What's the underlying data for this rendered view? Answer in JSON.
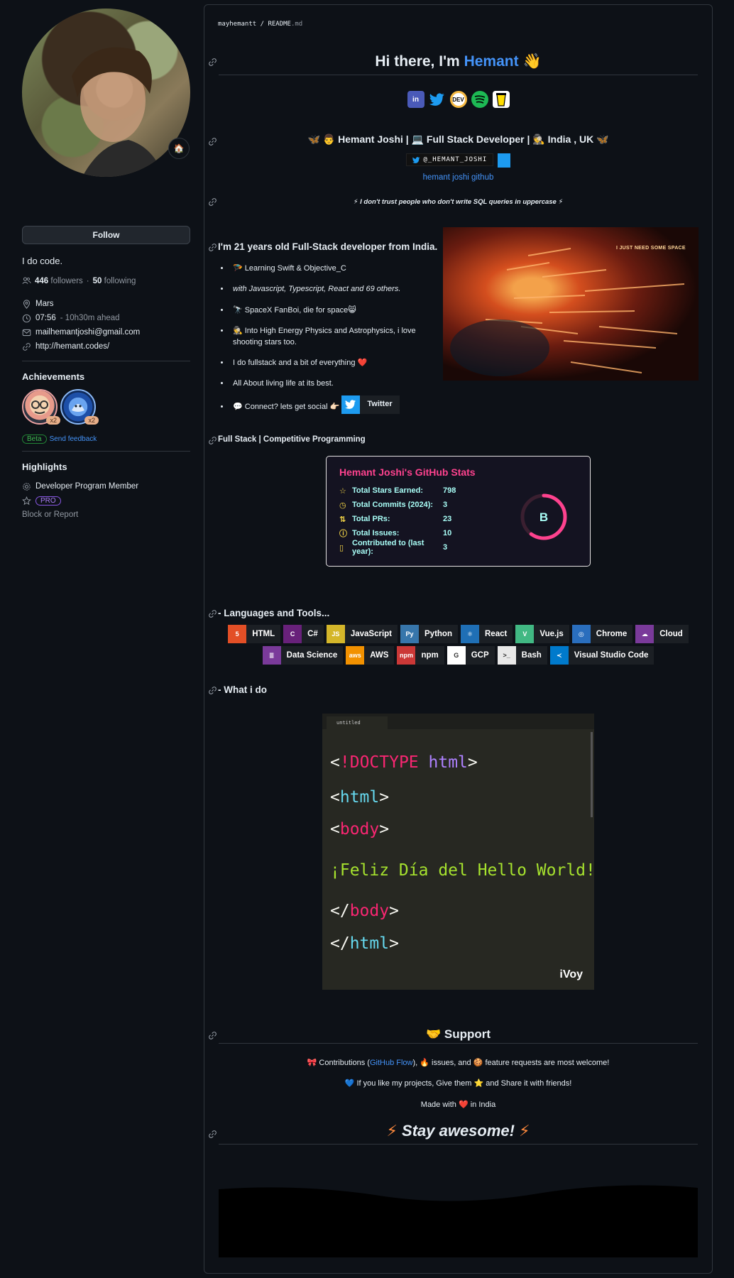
{
  "profile": {
    "status_emoji": "🏠",
    "follow_label": "Follow",
    "bio": "I do code.",
    "followers": "446",
    "followers_label": "followers",
    "following": "50",
    "following_label": "following",
    "location": "Mars",
    "local_time": "07:56",
    "time_ahead": "- 10h30m ahead",
    "email": "mailhemantjoshi@gmail.com",
    "website": "http://hemant.codes/",
    "achievements_title": "Achievements",
    "achievement_badges": [
      {
        "count": "x2"
      },
      {
        "count": "x2"
      }
    ],
    "beta_label": "Beta",
    "send_feedback": "Send feedback",
    "highlights_title": "Highlights",
    "developer_program": "Developer Program Member",
    "pro_label": "PRO",
    "block_report": "Block or Report"
  },
  "readme": {
    "breadcrumb_user": "mayhemantt",
    "breadcrumb_sep": "/",
    "breadcrumb_file": "README",
    "breadcrumb_ext": ".md",
    "greeting_prefix": "Hi there, I'm ",
    "greeting_name": "Hemant",
    "greeting_emoji": "👋",
    "social_icons": [
      "linkedin-icon",
      "twitter-icon",
      "dev-icon",
      "spotify-icon",
      "buymeacoffee-icon"
    ],
    "tagline": "🦋 👨 Hemant Joshi | 💻 Full Stack Developer | 🕵️ India , UK 🦋",
    "twitter_handle": "@_HEMANT_JOSHI",
    "github_alt": "hemant joshi github",
    "quote": "⚡ I don't trust people who don't write SQL queries in uppercase ⚡",
    "intro_heading": "I'm 21 years old Full-Stack developer from India.",
    "galaxy_caption": "I JUST NEED SOME SPACE",
    "bullets": [
      "🪂 Learning Swift & Objective_C",
      "with Javascript, Typescript, React and 69 others.",
      "🔭 SpaceX FanBoi, die for space😸",
      "🕵️ Into High Energy Physics and Astrophysics, i love shooting stars too.",
      "I do fullstack and a bit of everything ❤️",
      "All About living life at its best.",
      "💬 Connect? lets get social 👉🏻"
    ],
    "twitter_button": "Twitter",
    "fullstack_heading": "Full Stack | Competitive Programming",
    "stats": {
      "title": "Hemant Joshi's GitHub Stats",
      "rows": [
        {
          "label": "Total Stars Earned:",
          "value": "798",
          "icon": "star-icon"
        },
        {
          "label": "Total Commits (2024):",
          "value": "3",
          "icon": "history-icon"
        },
        {
          "label": "Total PRs:",
          "value": "23",
          "icon": "pull-request-icon"
        },
        {
          "label": "Total Issues:",
          "value": "10",
          "icon": "issue-icon"
        },
        {
          "label": "Contributed to (last year):",
          "value": "3",
          "icon": "repo-icon"
        }
      ],
      "rank": "B",
      "rank_progress": 0.6,
      "colors": {
        "title": "#fe428e",
        "text": "#a9fef7",
        "icon": "#f8d847",
        "bg": "#141321"
      }
    },
    "languages_heading": "- Languages and Tools...",
    "tools_row1": [
      {
        "name": "HTML",
        "color": "#e34f26",
        "glyph": "5"
      },
      {
        "name": "C#",
        "color": "#68217a",
        "glyph": "C"
      },
      {
        "name": "JavaScript",
        "color": "#d4b62a",
        "glyph": "JS"
      },
      {
        "name": "Python",
        "color": "#3776ab",
        "glyph": "Py"
      },
      {
        "name": "React",
        "color": "#1f6fb5",
        "glyph": "⚛"
      },
      {
        "name": "Vue.js",
        "color": "#41b883",
        "glyph": "V"
      },
      {
        "name": "Chrome",
        "color": "#2a6ebd",
        "glyph": "◎"
      },
      {
        "name": "Cloud",
        "color": "#7a3a9a",
        "glyph": "☁"
      }
    ],
    "tools_row2": [
      {
        "name": "Data Science",
        "color": "#7a3a9a",
        "glyph": "≣"
      },
      {
        "name": "AWS",
        "color": "#f29100",
        "glyph": "aws"
      },
      {
        "name": "npm",
        "color": "#cb3837",
        "glyph": "npm"
      },
      {
        "name": "GCP",
        "color": "#ffffff",
        "glyph": "G"
      },
      {
        "name": "Bash",
        "color": "#e8e8e8",
        "glyph": ">_"
      },
      {
        "name": "Visual Studio Code",
        "color": "#007acc",
        "glyph": "≺"
      }
    ],
    "what_i_do_heading": "- What i do",
    "code_tab": "untitled",
    "code_lines": {
      "l1_open": "<",
      "l1_bang": "!",
      "l1_doctype": "DOCTYPE",
      "l1_html": " html",
      "l1_close": ">",
      "l2_open": "<",
      "l2_tag": "html",
      "l2_close": ">",
      "l3_open": "<",
      "l3_tag": "body",
      "l3_close": ">",
      "l4_text": "¡Feliz Día del Hello World!",
      "l5_open": "</",
      "l5_tag": "body",
      "l5_close": ">",
      "l6_open": "</",
      "l6_tag": "html",
      "l6_close": ">"
    },
    "code_watermark": "iVoy",
    "support_heading": "🤝 Support",
    "support_line1_a": "🎀 Contributions (",
    "support_line1_link": "GitHub Flow",
    "support_line1_b": "), 🔥 issues, and 🍪 feature requests are most welcome!",
    "support_line2": "💙 If you like my projects, Give them ⭐ and Share it with friends!",
    "support_line3": "Made with ❤️ in India",
    "awesome_heading": "Stay awesome!",
    "awesome_emoji": "⚡"
  }
}
